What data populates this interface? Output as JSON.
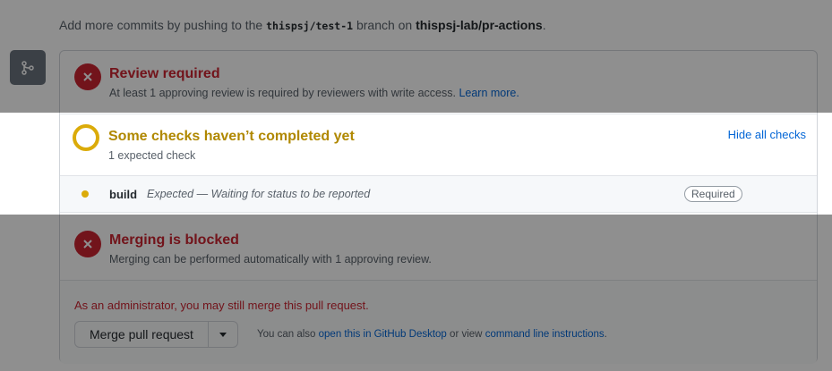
{
  "intro": {
    "prefix": "Add more commits by pushing to the",
    "branch": "thispsj/test-1",
    "middle": "branch on",
    "repo": "thispsj-lab/pr-actions",
    "suffix": "."
  },
  "review": {
    "title": "Review required",
    "subtitle": "At least 1 approving review is required by reviewers with write access.",
    "link": "Learn more."
  },
  "checks": {
    "title": "Some checks haven’t completed yet",
    "subtitle": "1 expected check",
    "toggle": "Hide all checks",
    "items": [
      {
        "name": "build",
        "status": "Expected — Waiting for status to be reported",
        "badge": "Required"
      }
    ]
  },
  "merge": {
    "title": "Merging is blocked",
    "subtitle": "Merging can be performed automatically with 1 approving review."
  },
  "admin": {
    "notice": "As an administrator, you may still merge this pull request.",
    "button": "Merge pull request",
    "also_prefix": "You can also",
    "desktop_link": "open this in GitHub Desktop",
    "also_middle": "or view",
    "cli_link": "command line instructions",
    "also_suffix": "."
  },
  "colors": {
    "danger": "#cb2431",
    "pending": "#dbab09",
    "link": "#0366d6"
  }
}
